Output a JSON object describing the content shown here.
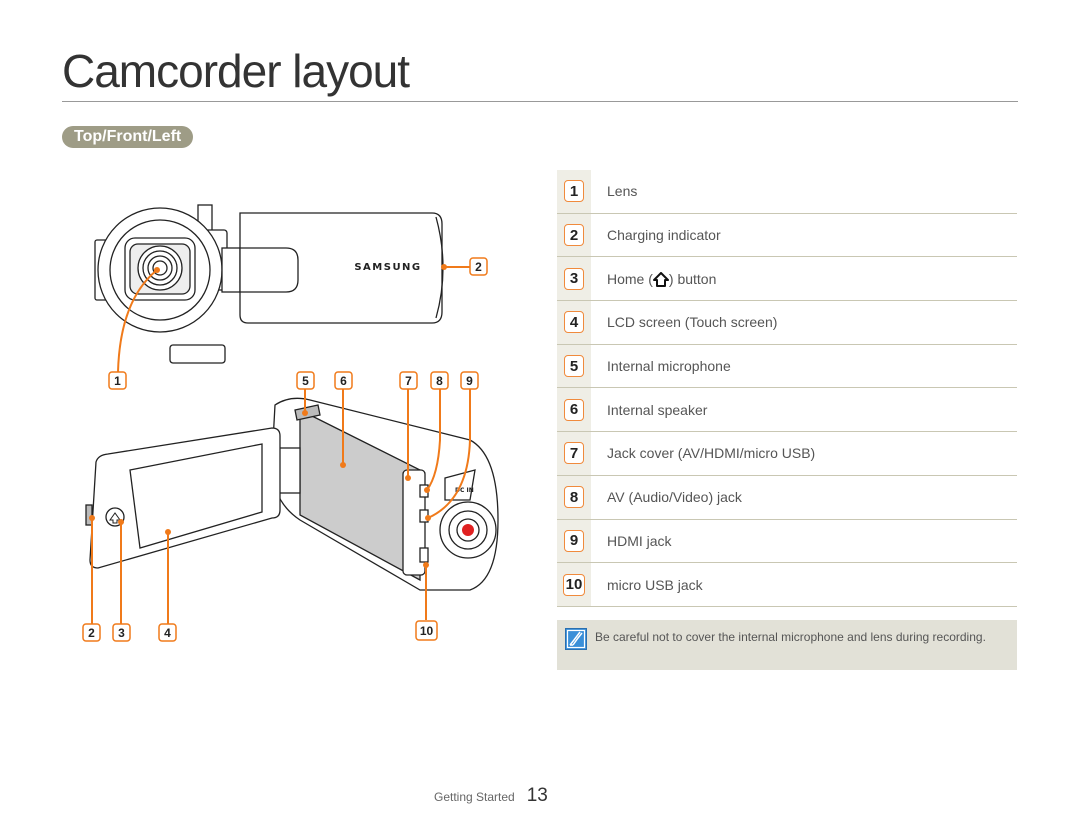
{
  "page": {
    "title": "Camcorder layout",
    "section_label": "Top/Front/Left"
  },
  "colors": {
    "accent": "#f08a3c",
    "pill": "#9e9c86",
    "row_tint": "#efeee6",
    "note_bg": "#e2e1d7",
    "note_icon": "#3a8fd8",
    "record_button": "#e02020"
  },
  "diagram": {
    "brand": "SAMSUNG",
    "dc_label": "DC IN",
    "callouts_top": [
      "1",
      "2"
    ],
    "callouts_mid": [
      "5",
      "6",
      "7",
      "8",
      "9"
    ],
    "callouts_bottom": [
      "2",
      "3",
      "4",
      "10"
    ]
  },
  "parts": [
    {
      "num": "1",
      "label": "Lens"
    },
    {
      "num": "2",
      "label": "Charging indicator"
    },
    {
      "num": "3",
      "label_before": "Home (",
      "icon": "home-icon",
      "label_after": ") button"
    },
    {
      "num": "4",
      "label": "LCD screen (Touch screen)"
    },
    {
      "num": "5",
      "label": "Internal microphone"
    },
    {
      "num": "6",
      "label": "Internal speaker"
    },
    {
      "num": "7",
      "label": "Jack cover (AV/HDMI/micro USB)"
    },
    {
      "num": "8",
      "label": "AV (Audio/Video) jack"
    },
    {
      "num": "9",
      "label": "HDMI jack"
    },
    {
      "num": "10",
      "label": "micro USB jack"
    }
  ],
  "note": {
    "icon": "note-pencil-icon",
    "text": "Be careful not to cover the internal microphone and lens during recording."
  },
  "footer": {
    "section": "Getting Started",
    "page_number": "13"
  }
}
